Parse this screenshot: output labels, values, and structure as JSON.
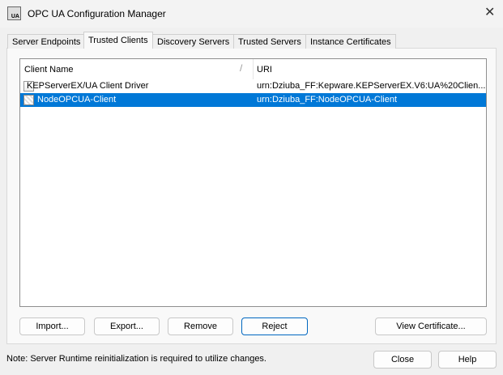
{
  "window": {
    "title": "OPC UA Configuration Manager",
    "icon": "opc-ua-app-icon",
    "icon_text": "UA",
    "close_glyph": "✕"
  },
  "tabs": [
    {
      "label": "Server Endpoints"
    },
    {
      "label": "Trusted Clients",
      "active": true
    },
    {
      "label": "Discovery Servers"
    },
    {
      "label": "Trusted Servers"
    },
    {
      "label": "Instance Certificates"
    }
  ],
  "list": {
    "columns": [
      "Client Name",
      "URI"
    ],
    "sort_glyph": "/",
    "rows": [
      {
        "name": "KEPServerEX/UA Client Driver",
        "uri": "urn:Dziuba_FF:Kepware.KEPServerEX.V6:UA%20Clien...",
        "selected": false
      },
      {
        "name": "NodeOPCUA-Client",
        "uri": "urn:Dziuba_FF:NodeOPCUA-Client",
        "selected": true
      }
    ]
  },
  "buttons": {
    "import": "Import...",
    "export": "Export...",
    "remove": "Remove",
    "reject": "Reject",
    "view_certificate": "View Certificate...",
    "close": "Close",
    "help": "Help"
  },
  "note": "Note: Server Runtime reinitialization is required to utilize changes.",
  "colors": {
    "selection": "#0078d7",
    "default_button_border": "#0067c0"
  }
}
